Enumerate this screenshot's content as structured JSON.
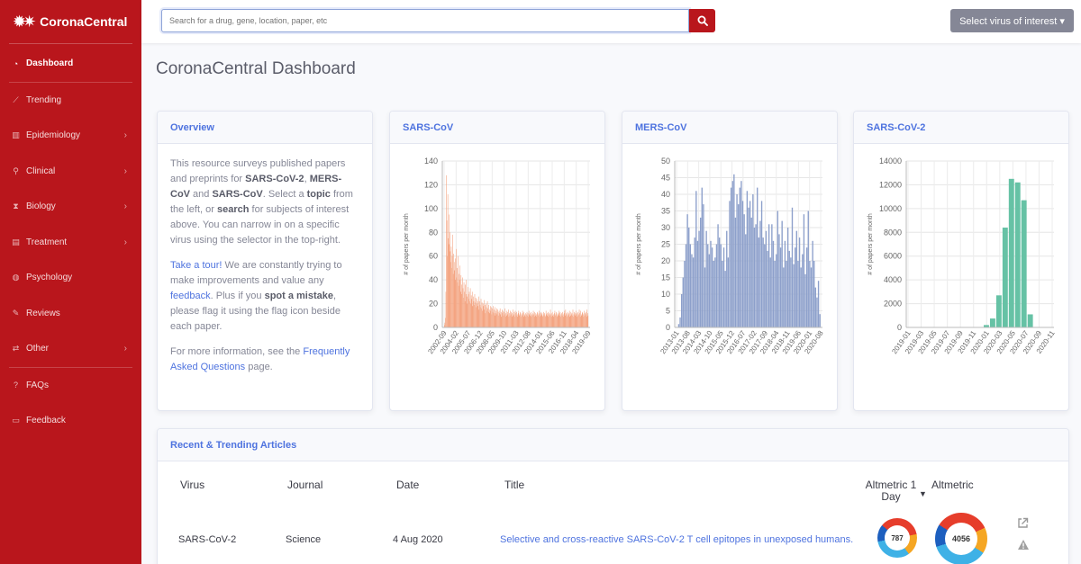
{
  "brand": {
    "name": "CoronaCentral",
    "logo_icon": "virus-icon"
  },
  "sidebar": {
    "items": [
      {
        "label": "Dashboard",
        "icon": "tachometer-icon",
        "active": true,
        "has_children": false
      },
      {
        "label": "Trending",
        "icon": "chart-line-icon",
        "active": false,
        "has_children": false
      },
      {
        "label": "Epidemiology",
        "icon": "chart-bar-icon",
        "active": false,
        "has_children": true
      },
      {
        "label": "Clinical",
        "icon": "stethoscope-icon",
        "active": false,
        "has_children": true
      },
      {
        "label": "Biology",
        "icon": "dna-icon",
        "active": false,
        "has_children": true
      },
      {
        "label": "Treatment",
        "icon": "pills-icon",
        "active": false,
        "has_children": true
      },
      {
        "label": "Psychology",
        "icon": "brain-icon",
        "active": false,
        "has_children": false
      },
      {
        "label": "Reviews",
        "icon": "pencil-icon",
        "active": false,
        "has_children": false
      },
      {
        "label": "Other",
        "icon": "random-icon",
        "active": false,
        "has_children": true
      },
      {
        "label": "FAQs",
        "icon": "question-circle-icon",
        "active": false,
        "has_children": false
      },
      {
        "label": "Feedback",
        "icon": "comment-icon",
        "active": false,
        "has_children": false
      }
    ]
  },
  "topbar": {
    "search_placeholder": "Search for a drug, gene, location, paper, etc",
    "virus_select_label": "Select virus of interest ▾"
  },
  "page_title": "CoronaCentral Dashboard",
  "overview": {
    "title": "Overview",
    "p1_a": "This resource surveys published papers and preprints for ",
    "p1_b1": "SARS-CoV-2",
    "p1_c": ", ",
    "p1_b2": "MERS-CoV",
    "p1_d": " and ",
    "p1_b3": "SARS-CoV",
    "p1_e": ". Select a ",
    "p1_b4": "topic",
    "p1_f": " from the left, or ",
    "p1_b5": "search",
    "p1_g": " for subjects of interest above. You can narrow in on a specific virus using the selector in the top-right.",
    "p2_link1": "Take a tour!",
    "p2_a": " We are constantly trying to make improvements and value any ",
    "p2_link2": "feedback",
    "p2_b": ". Plus if you ",
    "p2_b1": "spot a mistake",
    "p2_c": ", please flag it using the flag icon beside each paper.",
    "p3_a": "For more information, see the ",
    "p3_link": "Frequently Asked Questions",
    "p3_b": " page."
  },
  "chart_data": [
    {
      "type": "bar",
      "title": "SARS-CoV",
      "ylabel": "# of papers per month",
      "ylim": [
        0,
        140
      ],
      "yticks": [
        0,
        20,
        40,
        60,
        80,
        100,
        120,
        140
      ],
      "xtick_labels": [
        "2002-09",
        "2004-02",
        "2005-07",
        "2006-12",
        "2008-05",
        "2009-10",
        "2011-03",
        "2012-08",
        "2014-01",
        "2015-06",
        "2016-11",
        "2018-04",
        "2019-09"
      ],
      "color": "#f4a582",
      "values": [
        2,
        4,
        8,
        30,
        128,
        90,
        60,
        112,
        75,
        70,
        95,
        80,
        64,
        55,
        68,
        50,
        60,
        78,
        45,
        62,
        55,
        48,
        58,
        40,
        66,
        42,
        50,
        38,
        60,
        35,
        45,
        40,
        52,
        30,
        44,
        36,
        28,
        42,
        33,
        25,
        38,
        30,
        22,
        36,
        28,
        40,
        26,
        20,
        34,
        28,
        24,
        30,
        22,
        33,
        20,
        27,
        24,
        30,
        18,
        26,
        22,
        19,
        28,
        21,
        25,
        17,
        24,
        20,
        22,
        18,
        26,
        15,
        22,
        19,
        17,
        24,
        16,
        21,
        14,
        20,
        18,
        23,
        15,
        19,
        12,
        20,
        17,
        14,
        22,
        16,
        13,
        19,
        15,
        12,
        18,
        14,
        17,
        11,
        16,
        13,
        18,
        12,
        15,
        10,
        17,
        14,
        12,
        16,
        11,
        15,
        13,
        10,
        14,
        12,
        16,
        11,
        13,
        9,
        15,
        12,
        14,
        10,
        13,
        11,
        16,
        9,
        12,
        14,
        10,
        13,
        11,
        15,
        9,
        12,
        10,
        14,
        11,
        13,
        9,
        12,
        15,
        10,
        11,
        13,
        9,
        14,
        12,
        10,
        13,
        11,
        9,
        12,
        14,
        10,
        11,
        13,
        12,
        9,
        11,
        10,
        14,
        12,
        9,
        13,
        11,
        10,
        12,
        9,
        11,
        13,
        10,
        12,
        9,
        14,
        11,
        10,
        12,
        13,
        9,
        11,
        10,
        12,
        14,
        11,
        9,
        13,
        10,
        12,
        11,
        9,
        13,
        12,
        10,
        11,
        14,
        9,
        12,
        10,
        13,
        11,
        12,
        9,
        10,
        13,
        11,
        12,
        10,
        9,
        14,
        11,
        12,
        10,
        13,
        9,
        11,
        12,
        10,
        15,
        11,
        9,
        12,
        13,
        10,
        11,
        9,
        12,
        14,
        10,
        11,
        13,
        12,
        9,
        10,
        11,
        14,
        12,
        10,
        13,
        9,
        11,
        12,
        10,
        13,
        11,
        9,
        12,
        14,
        10,
        15,
        11,
        12,
        9,
        13,
        10,
        11,
        12,
        14,
        9,
        10,
        13,
        11,
        12,
        10,
        15,
        9,
        11,
        13,
        12,
        10,
        14,
        11,
        9,
        12,
        13,
        10,
        11,
        15,
        12,
        9,
        14,
        11,
        10,
        13,
        12,
        11,
        9,
        14,
        10,
        12,
        11,
        13,
        9,
        15,
        12,
        10
      ]
    },
    {
      "type": "bar",
      "title": "MERS-CoV",
      "ylabel": "# of papers per month",
      "ylim": [
        0,
        50
      ],
      "yticks": [
        0,
        5,
        10,
        15,
        20,
        25,
        30,
        35,
        40,
        45,
        50
      ],
      "xtick_labels": [
        "2013-01",
        "2013-08",
        "2014-03",
        "2014-10",
        "2015-05",
        "2015-12",
        "2016-07",
        "2017-02",
        "2017-09",
        "2018-04",
        "2018-11",
        "2019-06",
        "2020-01",
        "2020-08"
      ],
      "color": "#8da0cb",
      "values": [
        0,
        1,
        3,
        10,
        15,
        20,
        25,
        34,
        30,
        25,
        22,
        21,
        27,
        41,
        26,
        29,
        33,
        42,
        37,
        18,
        29,
        25,
        22,
        26,
        24,
        20,
        21,
        25,
        31,
        27,
        25,
        20,
        24,
        17,
        29,
        21,
        38,
        42,
        44,
        46,
        33,
        40,
        37,
        42,
        44,
        38,
        34,
        28,
        41,
        36,
        38,
        33,
        40,
        30,
        31,
        42,
        27,
        32,
        38,
        27,
        25,
        29,
        23,
        31,
        21,
        31,
        26,
        20,
        22,
        35,
        28,
        24,
        32,
        18,
        26,
        20,
        30,
        23,
        21,
        36,
        19,
        24,
        29,
        20,
        27,
        18,
        22,
        34,
        16,
        24,
        35,
        20,
        18,
        26,
        20,
        12,
        9,
        14,
        4
      ]
    },
    {
      "type": "bar",
      "title": "SARS-CoV-2",
      "ylabel": "# of papers per month",
      "ylim": [
        0,
        14000
      ],
      "yticks": [
        0,
        2000,
        4000,
        6000,
        8000,
        10000,
        12000,
        14000
      ],
      "xtick_labels": [
        "2019-01",
        "2019-03",
        "2019-05",
        "2019-07",
        "2019-09",
        "2019-11",
        "2020-01",
        "2020-03",
        "2020-05",
        "2020-07",
        "2020-09",
        "2020-11"
      ],
      "categories": [
        "2019-01",
        "2019-02",
        "2019-03",
        "2019-04",
        "2019-05",
        "2019-06",
        "2019-07",
        "2019-08",
        "2019-09",
        "2019-10",
        "2019-11",
        "2019-12",
        "2020-01",
        "2020-02",
        "2020-03",
        "2020-04",
        "2020-05",
        "2020-06",
        "2020-07",
        "2020-08",
        "2020-09",
        "2020-10",
        "2020-11"
      ],
      "color": "#66c2a5",
      "values": [
        0,
        0,
        0,
        0,
        0,
        0,
        0,
        0,
        0,
        0,
        0,
        30,
        200,
        750,
        2700,
        8400,
        12500,
        12200,
        10700,
        1100,
        0,
        0,
        0
      ]
    }
  ],
  "articles": {
    "title": "Recent & Trending Articles",
    "headers": {
      "virus": "Virus",
      "journal": "Journal",
      "date": "Date",
      "title": "Title",
      "alt1": "Altmetric 1 Day",
      "alt2": "Altmetric"
    },
    "rows": [
      {
        "virus": "SARS-CoV-2",
        "journal": "Science",
        "date": "4 Aug 2020",
        "title": "Selective and cross-reactive SARS-CoV-2 T cell epitopes in unexposed humans.",
        "alt1": "787",
        "alt2": "4056"
      }
    ]
  }
}
